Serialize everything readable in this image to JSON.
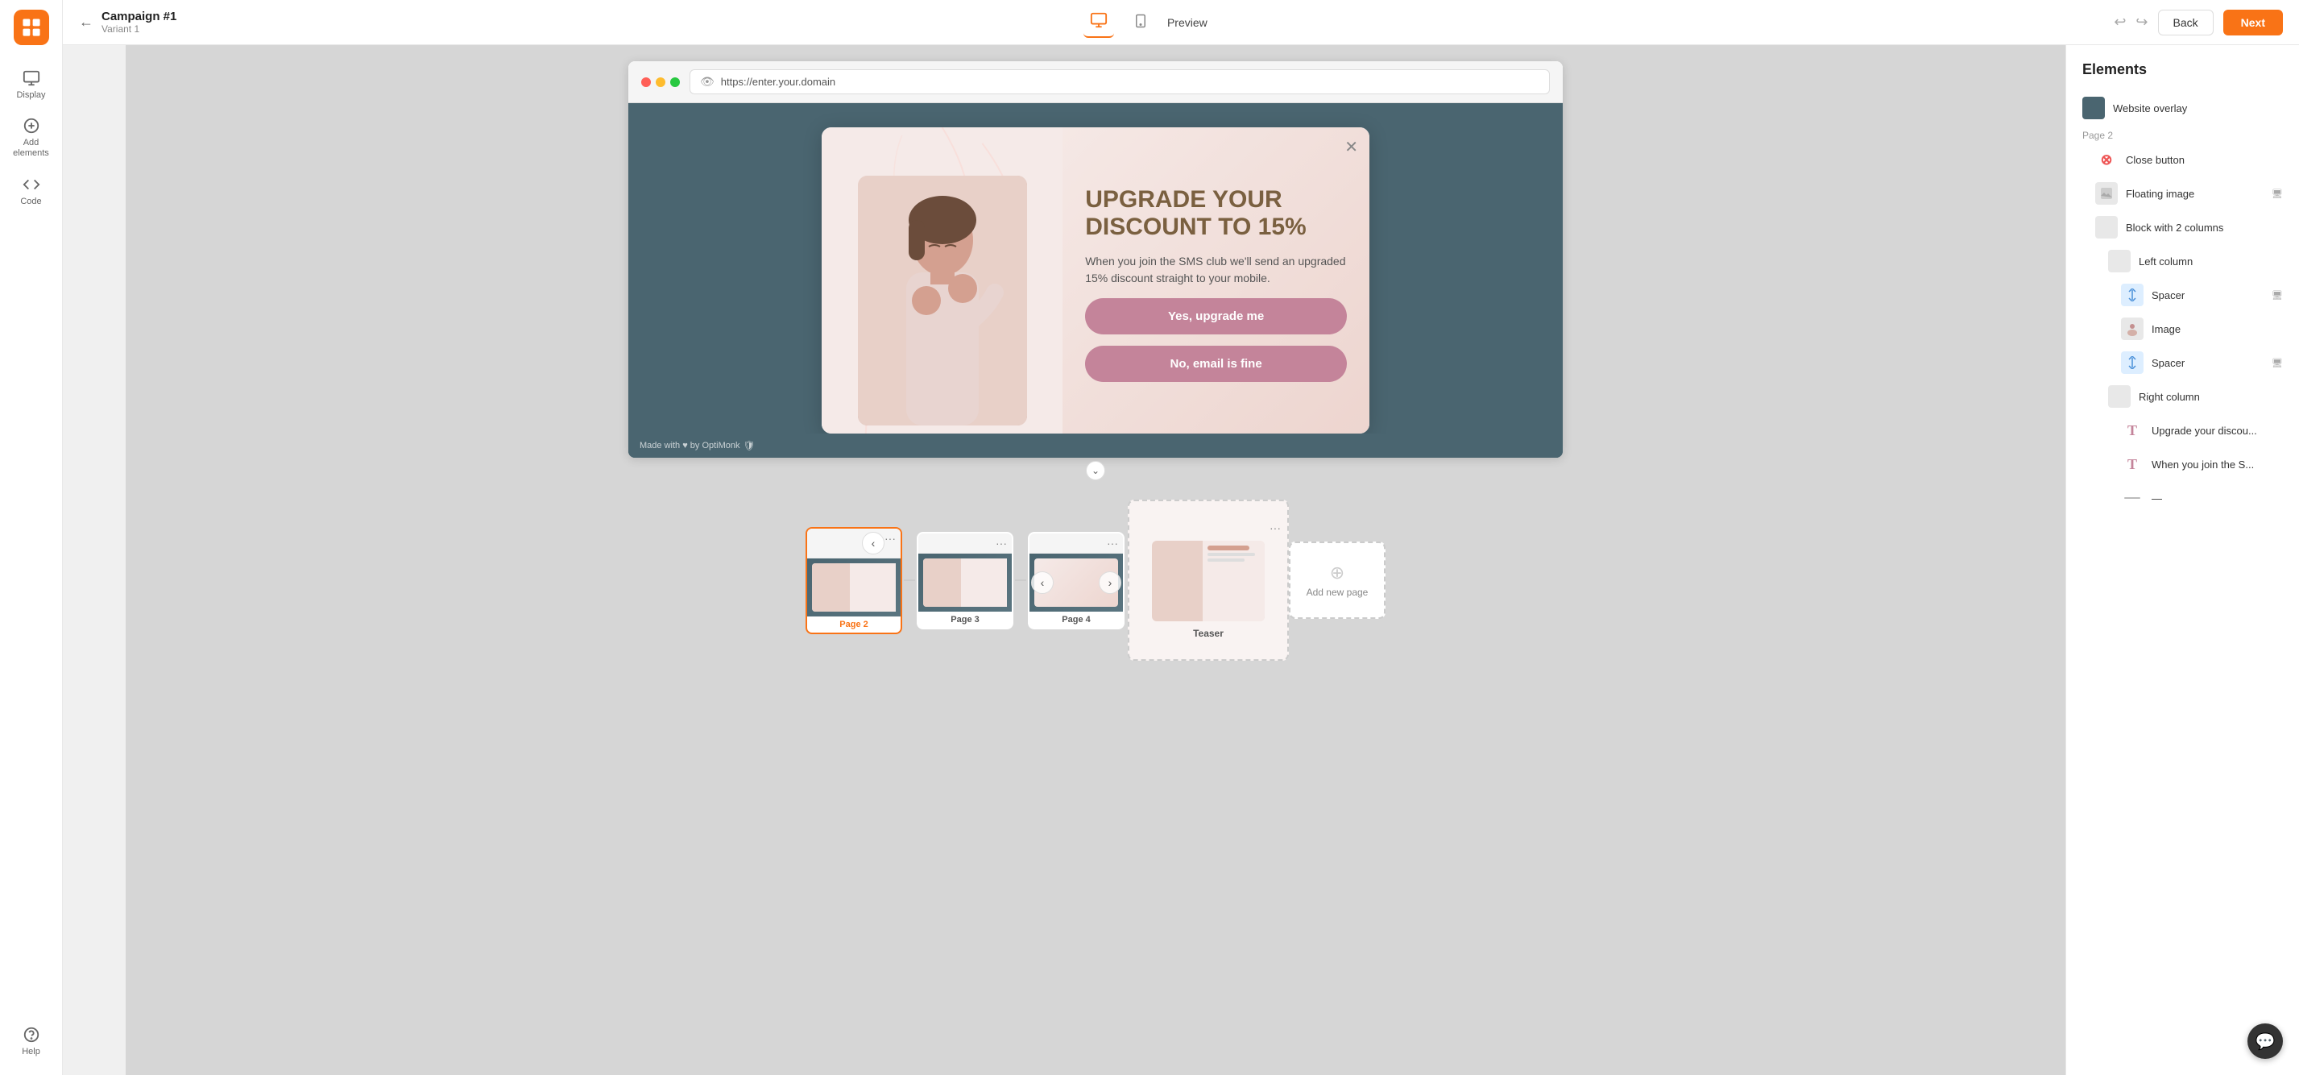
{
  "header": {
    "campaign_name": "Campaign #1",
    "variant": "Variant 1",
    "preview_label": "Preview",
    "back_label": "Back",
    "next_label": "Next"
  },
  "toolbar": {
    "undo_symbol": "↩",
    "redo_symbol": "↪"
  },
  "sidebar": {
    "items": [
      {
        "label": "Display",
        "icon": "display-icon"
      },
      {
        "label": "Add elements",
        "icon": "add-icon"
      },
      {
        "label": "Code",
        "icon": "code-icon"
      },
      {
        "label": "Help",
        "icon": "help-icon"
      }
    ]
  },
  "browser": {
    "url": "https://enter.your.domain"
  },
  "popup": {
    "headline": "UPGRADE YOUR DISCOUNT TO 15%",
    "subtext": "When you join the SMS club we'll send an upgraded 15% discount straight to your mobile.",
    "btn_primary": "Yes, upgrade me",
    "btn_secondary": "No, email is fine",
    "footer": "Made with ♥ by OptiMonk"
  },
  "pages": [
    {
      "label": "Page 2",
      "active": true
    },
    {
      "label": "Page 3",
      "active": false
    },
    {
      "label": "Page 4",
      "active": false
    },
    {
      "label": "Teaser",
      "active": false
    }
  ],
  "add_page": {
    "label": "Add new page"
  },
  "right_panel": {
    "title": "Elements",
    "items": [
      {
        "type": "website-overlay",
        "label": "Website overlay",
        "indent": 0
      },
      {
        "type": "section",
        "label": "Page 2",
        "indent": 0
      },
      {
        "type": "close-button",
        "label": "Close button",
        "indent": 1
      },
      {
        "type": "floating-image",
        "label": "Floating image",
        "indent": 1,
        "has_screen": true
      },
      {
        "type": "block-2-columns",
        "label": "Block with 2 columns",
        "indent": 1
      },
      {
        "type": "left-column",
        "label": "Left column",
        "indent": 2
      },
      {
        "type": "spacer",
        "label": "Spacer",
        "indent": 3,
        "has_screen": true
      },
      {
        "type": "image",
        "label": "Image",
        "indent": 3
      },
      {
        "type": "spacer2",
        "label": "Spacer",
        "indent": 3,
        "has_screen": true
      },
      {
        "type": "right-column",
        "label": "Right column",
        "indent": 2
      },
      {
        "type": "text-upgrade",
        "label": "Upgrade your discou...",
        "indent": 3
      },
      {
        "type": "text-when",
        "label": "When you join the S...",
        "indent": 3
      },
      {
        "type": "divider",
        "label": "—",
        "indent": 3
      }
    ]
  }
}
